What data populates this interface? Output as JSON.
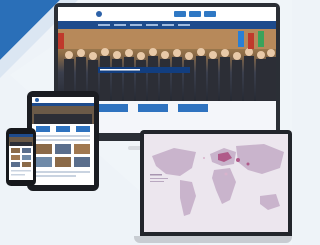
{
  "website": {
    "site_name": "",
    "tile_labels": [
      "",
      "",
      ""
    ]
  },
  "colors": {
    "brand_blue": "#1e4b8c",
    "accent_red": "#c0392b",
    "map_pink": "#b05a8a"
  }
}
